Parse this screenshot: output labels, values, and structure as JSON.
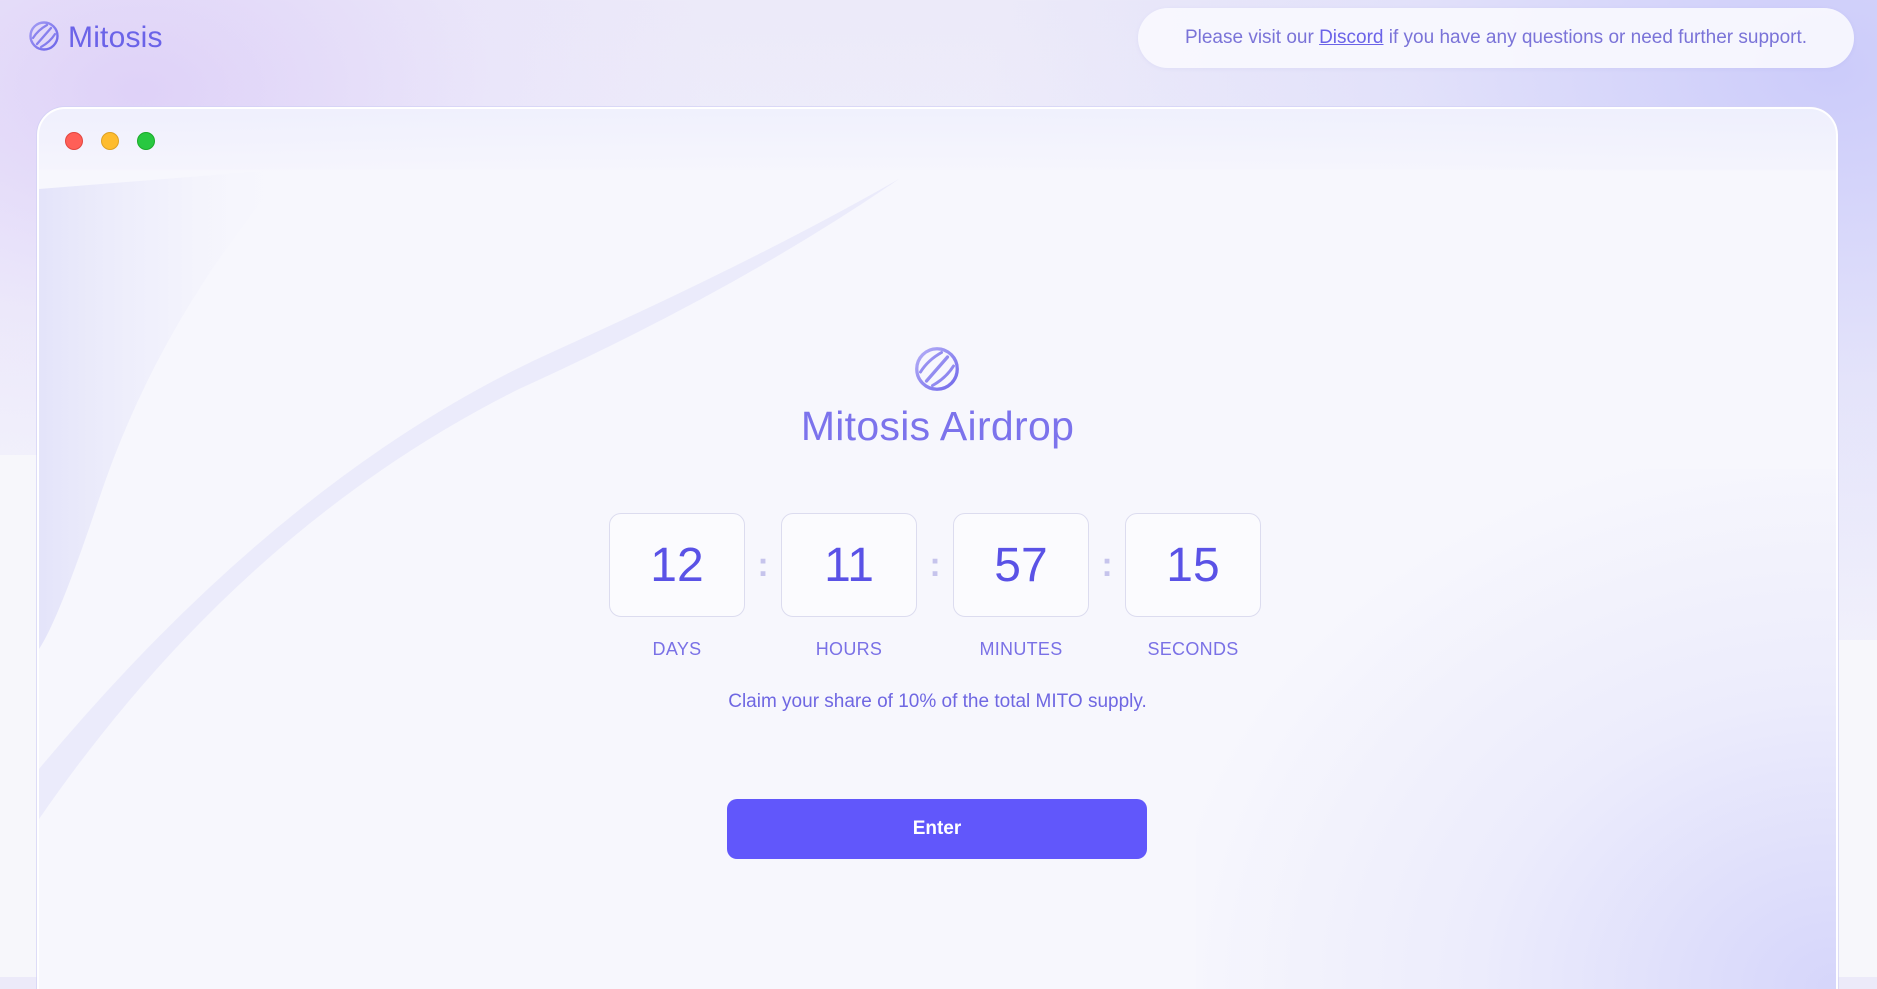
{
  "brand": {
    "name": "Mitosis",
    "logo_icon": "mitosis-orb-icon"
  },
  "support": {
    "prefix": "Please visit our ",
    "link_text": "Discord",
    "suffix": " if you have any questions or need further support."
  },
  "window_controls": [
    "close",
    "minimize",
    "maximize"
  ],
  "hero": {
    "logo_icon": "mitosis-orb-icon",
    "title": "Mitosis Airdrop"
  },
  "countdown": {
    "days": "12",
    "hours": "11",
    "minutes": "57",
    "seconds": "15",
    "separator": ":",
    "labels": {
      "days": "DAYS",
      "hours": "HOURS",
      "minutes": "MINUTES",
      "seconds": "SECONDS"
    }
  },
  "claim_text": "Claim your share of 10% of the total MITO supply.",
  "enter_label": "Enter",
  "colors": {
    "accent": "#6157fb",
    "title": "#7c73ec",
    "digits": "#5a52e6"
  }
}
